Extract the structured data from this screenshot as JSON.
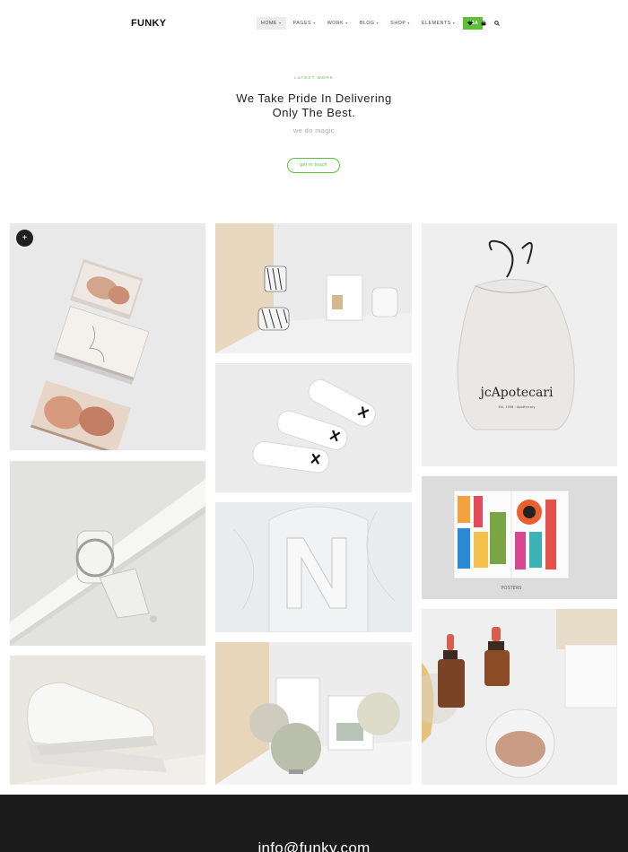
{
  "header": {
    "logo": "FUNKY",
    "nav": [
      {
        "label": "HOME",
        "active": true
      },
      {
        "label": "PAGES",
        "active": false
      },
      {
        "label": "WORK",
        "active": false
      },
      {
        "label": "BLOG",
        "active": false
      },
      {
        "label": "SHOP",
        "active": false
      },
      {
        "label": "ELEMENTS",
        "active": false
      }
    ],
    "lang_button": "USA",
    "icons": [
      "heart-icon",
      "cart-icon",
      "search-icon"
    ]
  },
  "hero": {
    "eyebrow": "LATEST WORK",
    "headline_line1": "We Take Pride In Delivering",
    "headline_line2": "Only The Best.",
    "subtitle": "we do magic",
    "cta": "get in touch"
  },
  "gallery": {
    "expand_symbol": "+",
    "bag_brand": "jcApotecari",
    "bag_tagline": "Est. 1998 · Apothecary",
    "poster_letters": "POSTERS",
    "items": [
      {
        "name": "magazines"
      },
      {
        "name": "cups-and-box"
      },
      {
        "name": "white-sneakers"
      },
      {
        "name": "drawstring-bag"
      },
      {
        "name": "clamp-lamp"
      },
      {
        "name": "marble-n-sculpture"
      },
      {
        "name": "posters-magazine"
      },
      {
        "name": "stapler"
      },
      {
        "name": "round-mirrors"
      },
      {
        "name": "bottles-and-soap"
      }
    ]
  },
  "footer": {
    "email": "info@funky.com"
  },
  "colors": {
    "accent": "#5cc138",
    "footer_bg": "#1c1c1c",
    "tile_bg": "#e6e6e6"
  }
}
